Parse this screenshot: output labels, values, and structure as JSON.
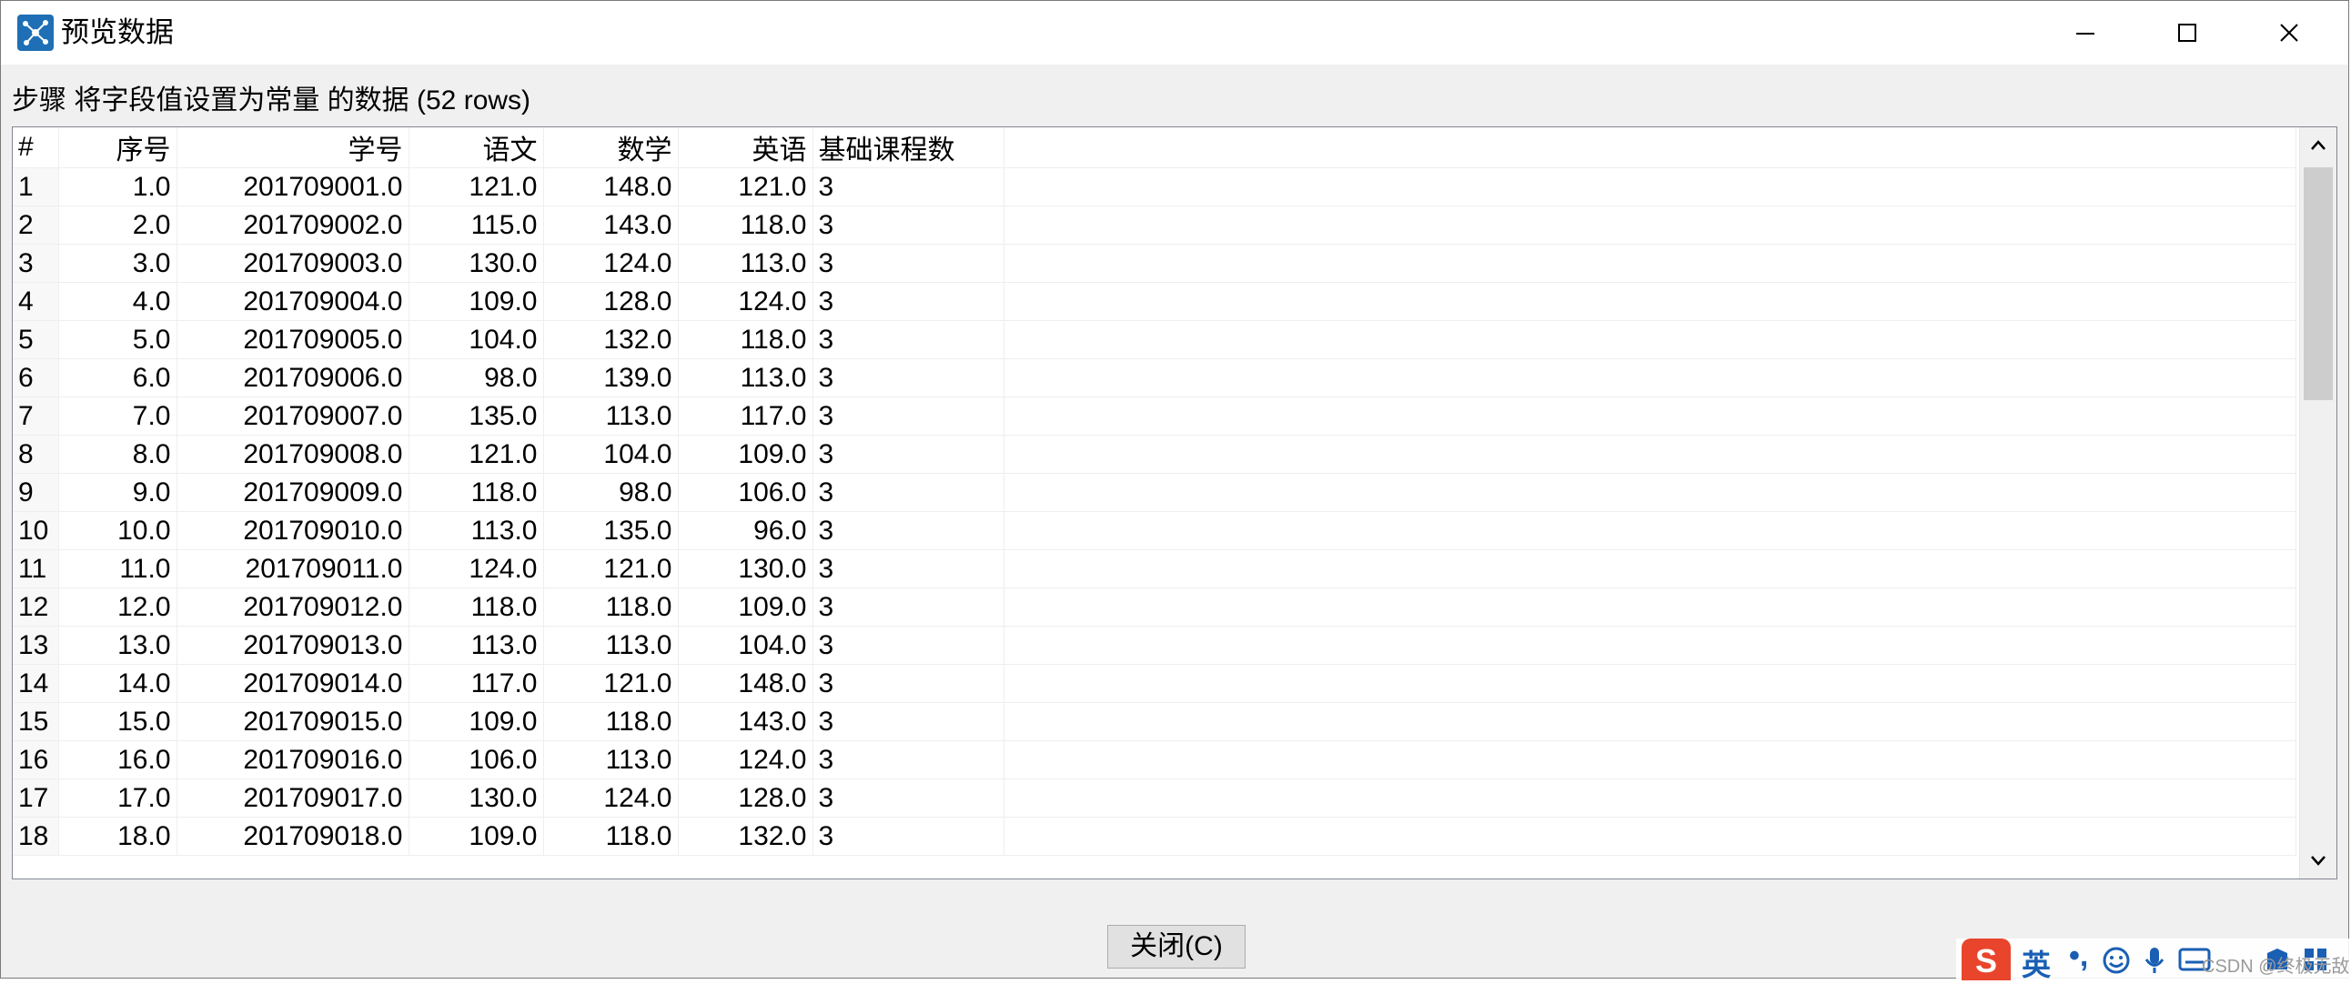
{
  "window": {
    "title": "预览数据",
    "accent_color": "#1e6fb5"
  },
  "step_label": "步骤 将字段值设置为常量 的数据  (52 rows)",
  "table": {
    "columns": [
      "#",
      "序号",
      "学号",
      "语文",
      "数学",
      "英语",
      "基础课程数"
    ],
    "rows": [
      [
        "1",
        "1.0",
        "201709001.0",
        "121.0",
        "148.0",
        "121.0",
        "3"
      ],
      [
        "2",
        "2.0",
        "201709002.0",
        "115.0",
        "143.0",
        "118.0",
        "3"
      ],
      [
        "3",
        "3.0",
        "201709003.0",
        "130.0",
        "124.0",
        "113.0",
        "3"
      ],
      [
        "4",
        "4.0",
        "201709004.0",
        "109.0",
        "128.0",
        "124.0",
        "3"
      ],
      [
        "5",
        "5.0",
        "201709005.0",
        "104.0",
        "132.0",
        "118.0",
        "3"
      ],
      [
        "6",
        "6.0",
        "201709006.0",
        "98.0",
        "139.0",
        "113.0",
        "3"
      ],
      [
        "7",
        "7.0",
        "201709007.0",
        "135.0",
        "113.0",
        "117.0",
        "3"
      ],
      [
        "8",
        "8.0",
        "201709008.0",
        "121.0",
        "104.0",
        "109.0",
        "3"
      ],
      [
        "9",
        "9.0",
        "201709009.0",
        "118.0",
        "98.0",
        "106.0",
        "3"
      ],
      [
        "10",
        "10.0",
        "201709010.0",
        "113.0",
        "135.0",
        "96.0",
        "3"
      ],
      [
        "11",
        "11.0",
        "201709011.0",
        "124.0",
        "121.0",
        "130.0",
        "3"
      ],
      [
        "12",
        "12.0",
        "201709012.0",
        "118.0",
        "118.0",
        "109.0",
        "3"
      ],
      [
        "13",
        "13.0",
        "201709013.0",
        "113.0",
        "113.0",
        "104.0",
        "3"
      ],
      [
        "14",
        "14.0",
        "201709014.0",
        "117.0",
        "121.0",
        "148.0",
        "3"
      ],
      [
        "15",
        "15.0",
        "201709015.0",
        "109.0",
        "118.0",
        "143.0",
        "3"
      ],
      [
        "16",
        "16.0",
        "201709016.0",
        "106.0",
        "113.0",
        "124.0",
        "3"
      ],
      [
        "17",
        "17.0",
        "201709017.0",
        "130.0",
        "124.0",
        "128.0",
        "3"
      ],
      [
        "18",
        "18.0",
        "201709018.0",
        "109.0",
        "118.0",
        "132.0",
        "3"
      ]
    ]
  },
  "buttons": {
    "close_label": "关闭(C)"
  },
  "ime": {
    "logo": "S",
    "lang": "英",
    "punct": "•,",
    "icons": [
      "emoji-icon",
      "microphone-icon",
      "keyboard-icon",
      "skin-icon",
      "toolbox-icon"
    ],
    "brand_color": "#e8452c"
  },
  "watermark": "CSDN @终极无敌"
}
